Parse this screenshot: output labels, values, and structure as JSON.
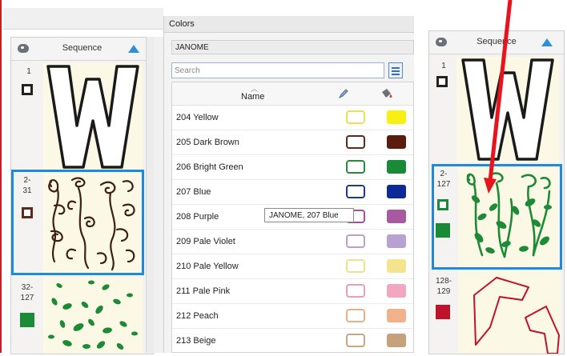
{
  "colors_panel": {
    "title": "Colors",
    "brand": "JANOME",
    "search_placeholder": "Search",
    "column_name": "Name",
    "tooltip": "JANOME, 207 Blue",
    "rows": [
      {
        "label": "204 Yellow",
        "outline": "#e8e05a",
        "fill": "#f7f012"
      },
      {
        "label": "205 Dark Brown",
        "outline": "#5a2a1c",
        "fill": "#5b1c10"
      },
      {
        "label": "206 Bright Green",
        "outline": "#2a8a3a",
        "fill": "#198a35"
      },
      {
        "label": "207 Blue",
        "outline": "#1d3a8a",
        "fill": "#0e2a96"
      },
      {
        "label": "208 Purple",
        "outline": "#a050a0",
        "fill": "#a85aa0"
      },
      {
        "label": "209 Pale Violet",
        "outline": "#b8a0d0",
        "fill": "#b7a2d2"
      },
      {
        "label": "210 Pale Yellow",
        "outline": "#f0e090",
        "fill": "#f5e48e"
      },
      {
        "label": "211 Pale Pink",
        "outline": "#e8a0b8",
        "fill": "#f2a6bf"
      },
      {
        "label": "212 Peach",
        "outline": "#e6b08a",
        "fill": "#f2b189"
      },
      {
        "label": "213 Beige",
        "outline": "#c8a880",
        "fill": "#c6a27a"
      }
    ]
  },
  "sequence_left": {
    "title": "Sequence",
    "items": [
      {
        "num": "1",
        "swatch": "#222222"
      },
      {
        "num": "2-\n31",
        "swatch": "#5a2a1c"
      },
      {
        "num": "32-\n127",
        "swatch": "#198a35"
      }
    ]
  },
  "sequence_right": {
    "title": "Sequence",
    "items": [
      {
        "num": "1",
        "swatch": "#222222"
      },
      {
        "num": "2-\n127",
        "swatch": "#198a35"
      },
      {
        "num": "128-\n129",
        "swatch": "#c0122a"
      }
    ]
  },
  "accent": "#1f8ad8"
}
